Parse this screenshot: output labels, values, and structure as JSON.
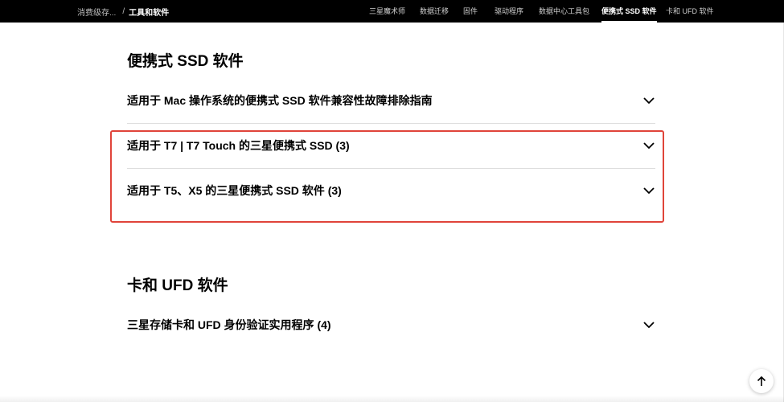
{
  "breadcrumb": {
    "previous": "消费级存...",
    "separator": "/",
    "current": "工具和软件"
  },
  "nav": {
    "items": [
      {
        "label": "三星魔术师"
      },
      {
        "label": "数据迁移"
      },
      {
        "label": "固件"
      },
      {
        "label": "驱动程序"
      },
      {
        "label": "数据中心工具包"
      },
      {
        "label": "便携式 SSD 软件",
        "active": true
      },
      {
        "label": "卡和 UFD 软件"
      }
    ]
  },
  "sections": [
    {
      "title": "便携式 SSD 软件",
      "items": [
        {
          "label": "适用于 Mac 操作系统的便携式 SSD 软件兼容性故障排除指南"
        },
        {
          "label": "适用于 T7 | T7 Touch 的三星便携式 SSD (3)"
        },
        {
          "label": "适用于 T5、X5 的三星便携式 SSD 软件 (3)"
        }
      ]
    },
    {
      "title": "卡和 UFD 软件",
      "items": [
        {
          "label": "三星存储卡和 UFD 身份验证实用程序 (4)"
        }
      ]
    }
  ],
  "colors": {
    "topbar_bg": "#000000",
    "highlight_border": "#e0443a",
    "divider": "#dedede"
  },
  "icons": {
    "accordion_toggle": "chevron-down-icon",
    "scroll_top": "arrow-up-icon"
  }
}
